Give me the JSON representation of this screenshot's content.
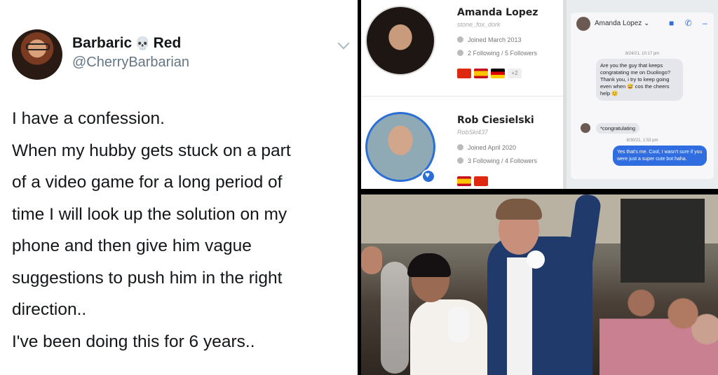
{
  "tweet": {
    "display_name_first": "Barbaric",
    "display_name_emoji": "💀",
    "display_name_last": "Red",
    "handle": "@CherryBarbarian",
    "lines": [
      "I have a confession.",
      "When my hubby gets stuck on a part",
      "of a video game for a long period of",
      "time I will look up the solution on my",
      "phone and then give him vague",
      "suggestions to push him in the right",
      "direction..",
      "I've been doing this for 6 years.."
    ]
  },
  "profiles": [
    {
      "name": "Amanda Lopez",
      "username": "stone_fox_dork",
      "joined": "Joined March 2013",
      "follow": "2 Following / 5 Followers",
      "flags": [
        "cn",
        "es",
        "de"
      ],
      "more": "+2"
    },
    {
      "name": "Rob Ciesielski",
      "username": "RobSki437",
      "joined": "Joined April 2020",
      "follow": "3 Following / 4 Followers",
      "flags": [
        "es",
        "cn"
      ]
    }
  ],
  "messenger": {
    "contact": "Amanda Lopez ⌄",
    "icons": "■ ✆ –",
    "ts1": "8/24/21, 10:17 pm",
    "msg1": "Are you the guy that keeps congratating me on Duolingo? Thank you, i try to keep going even when 😅 cos the cheers help 😊",
    "msg2": "*congratulating",
    "ts2": "8/30/21, 1:53 pm",
    "reply": "Yes that's me. Cool, I wasn't sure if you were just a super cute bot haha."
  }
}
